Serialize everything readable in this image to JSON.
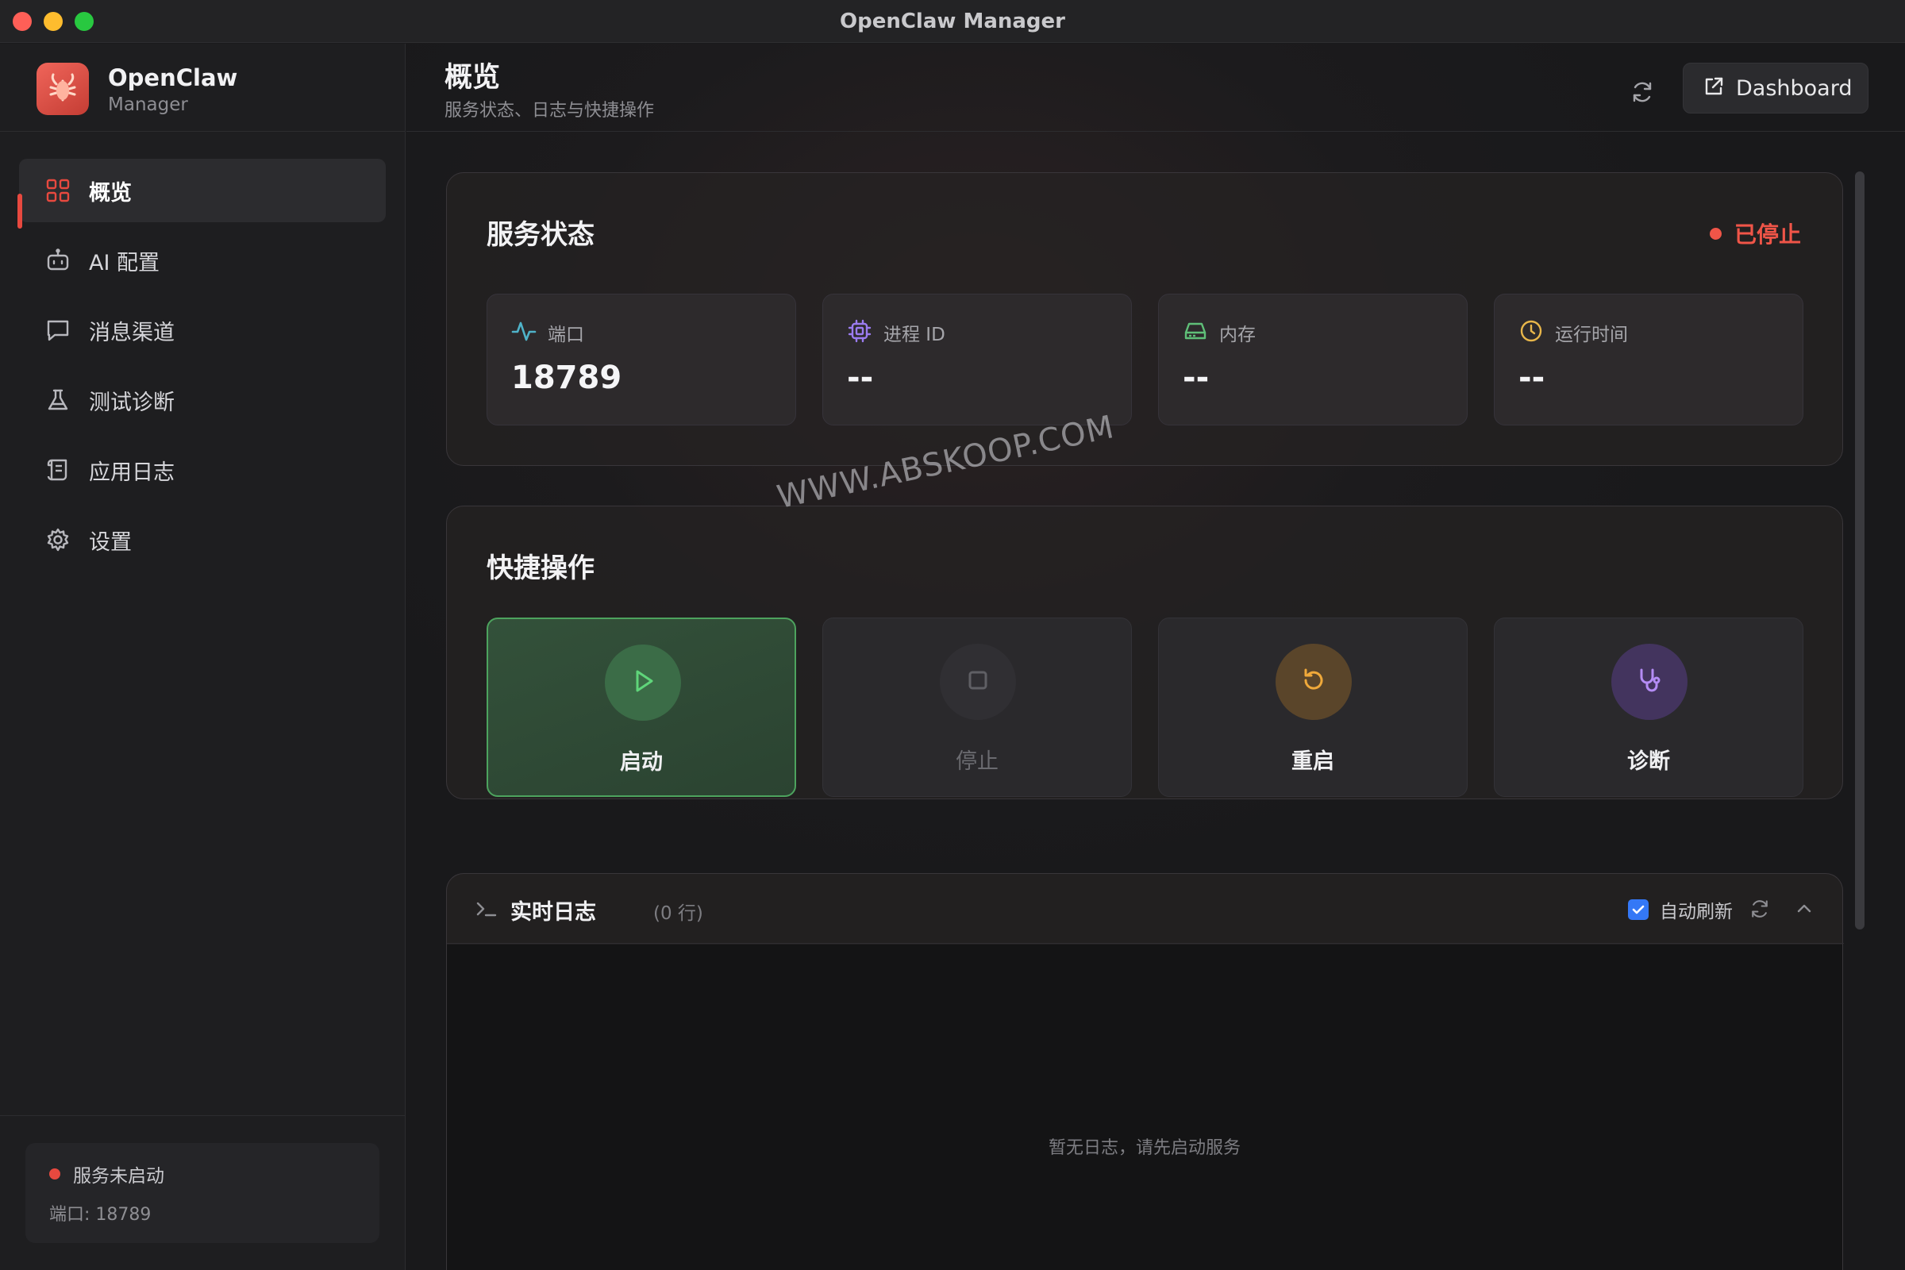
{
  "window": {
    "title": "OpenClaw Manager"
  },
  "brand": {
    "name": "OpenClaw",
    "subtitle": "Manager"
  },
  "sidebar": {
    "items": [
      {
        "label": "概览",
        "icon": "grid-icon",
        "active": true
      },
      {
        "label": "AI 配置",
        "icon": "robot-icon"
      },
      {
        "label": "消息渠道",
        "icon": "message-icon"
      },
      {
        "label": "测试诊断",
        "icon": "flask-icon"
      },
      {
        "label": "应用日志",
        "icon": "scroll-icon"
      },
      {
        "label": "设置",
        "icon": "gear-icon"
      }
    ],
    "status": {
      "text": "服务未启动",
      "port": "端口: 18789"
    }
  },
  "header": {
    "title": "概览",
    "subtitle": "服务状态、日志与快捷操作",
    "dashboard_label": "Dashboard"
  },
  "service_status": {
    "title": "服务状态",
    "state": "已停止",
    "stats": [
      {
        "label": "端口",
        "value": "18789",
        "icon": "pulse-icon",
        "color": "#4fb3c9"
      },
      {
        "label": "进程 ID",
        "value": "--",
        "icon": "cpu-icon",
        "color": "#9b7cf0"
      },
      {
        "label": "内存",
        "value": "--",
        "icon": "drive-icon",
        "color": "#5fbf78"
      },
      {
        "label": "运行时间",
        "value": "--",
        "icon": "clock-icon",
        "color": "#e8b64a"
      }
    ]
  },
  "quick_actions": {
    "title": "快捷操作",
    "actions": [
      {
        "label": "启动",
        "icon": "play-icon",
        "color": "#4dbb63"
      },
      {
        "label": "停止",
        "icon": "stop-icon",
        "color": "#55555a"
      },
      {
        "label": "重启",
        "icon": "restart-icon",
        "color": "#e8a33a"
      },
      {
        "label": "诊断",
        "icon": "stethoscope-icon",
        "color": "#a57cf0"
      }
    ]
  },
  "log": {
    "title": "实时日志",
    "count": "(0 行)",
    "auto_refresh_label": "自动刷新",
    "auto_refresh": true,
    "empty": "暂无日志，请先启动服务"
  },
  "watermark": "WWW.ABSKOOP.COM"
}
